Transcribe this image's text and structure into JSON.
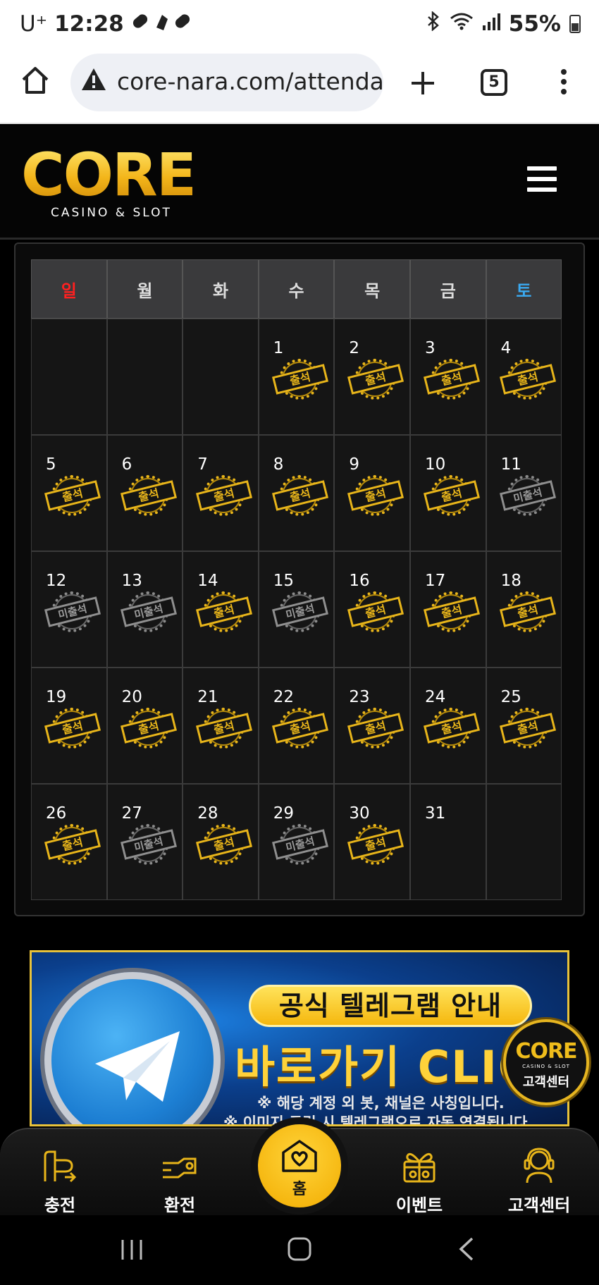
{
  "status_bar": {
    "carrier": "U⁺",
    "time": "12:28",
    "battery": "55%"
  },
  "browser": {
    "url": "core-nara.com/attenda",
    "tab_count": "5"
  },
  "site": {
    "logo_text": "CORE",
    "logo_sub": "CASINO & SLOT"
  },
  "calendar": {
    "weekdays": [
      "일",
      "월",
      "화",
      "수",
      "목",
      "금",
      "토"
    ],
    "stamp_attended": "출석",
    "stamp_missed": "미출석",
    "weeks": [
      [
        {
          "day": "",
          "status": "none"
        },
        {
          "day": "",
          "status": "none"
        },
        {
          "day": "",
          "status": "none"
        },
        {
          "day": "1",
          "status": "attended"
        },
        {
          "day": "2",
          "status": "attended"
        },
        {
          "day": "3",
          "status": "attended"
        },
        {
          "day": "4",
          "status": "attended"
        }
      ],
      [
        {
          "day": "5",
          "status": "attended"
        },
        {
          "day": "6",
          "status": "attended"
        },
        {
          "day": "7",
          "status": "attended"
        },
        {
          "day": "8",
          "status": "attended"
        },
        {
          "day": "9",
          "status": "attended"
        },
        {
          "day": "10",
          "status": "attended"
        },
        {
          "day": "11",
          "status": "missed"
        }
      ],
      [
        {
          "day": "12",
          "status": "missed"
        },
        {
          "day": "13",
          "status": "missed"
        },
        {
          "day": "14",
          "status": "attended"
        },
        {
          "day": "15",
          "status": "missed"
        },
        {
          "day": "16",
          "status": "attended"
        },
        {
          "day": "17",
          "status": "attended"
        },
        {
          "day": "18",
          "status": "attended"
        }
      ],
      [
        {
          "day": "19",
          "status": "attended"
        },
        {
          "day": "20",
          "status": "attended"
        },
        {
          "day": "21",
          "status": "attended"
        },
        {
          "day": "22",
          "status": "attended"
        },
        {
          "day": "23",
          "status": "attended"
        },
        {
          "day": "24",
          "status": "attended"
        },
        {
          "day": "25",
          "status": "attended"
        }
      ],
      [
        {
          "day": "26",
          "status": "attended"
        },
        {
          "day": "27",
          "status": "missed"
        },
        {
          "day": "28",
          "status": "attended"
        },
        {
          "day": "29",
          "status": "missed"
        },
        {
          "day": "30",
          "status": "attended"
        },
        {
          "day": "31",
          "status": "none"
        },
        {
          "day": "",
          "status": "none"
        }
      ]
    ]
  },
  "banner": {
    "pill": "공식 텔레그램 안내",
    "title": "바로가기 CLICK",
    "note1": "※ 해당 계정 외 봇, 채널은 사칭입니다.",
    "note2": "※ 이미지 클릭 시 텔레그램으로 자동 연결됩니다."
  },
  "cs_float": {
    "logo": "CORE",
    "sub": "CASINO & SLOT",
    "label": "고객센터"
  },
  "bottom_nav": {
    "items": [
      "충전",
      "환전",
      "홈",
      "이벤트",
      "고객센터"
    ]
  },
  "colors": {
    "gold": "#e8b51a",
    "sunday": "#ff2020",
    "saturday": "#3aaaf2",
    "missed": "#8f8f8f"
  }
}
